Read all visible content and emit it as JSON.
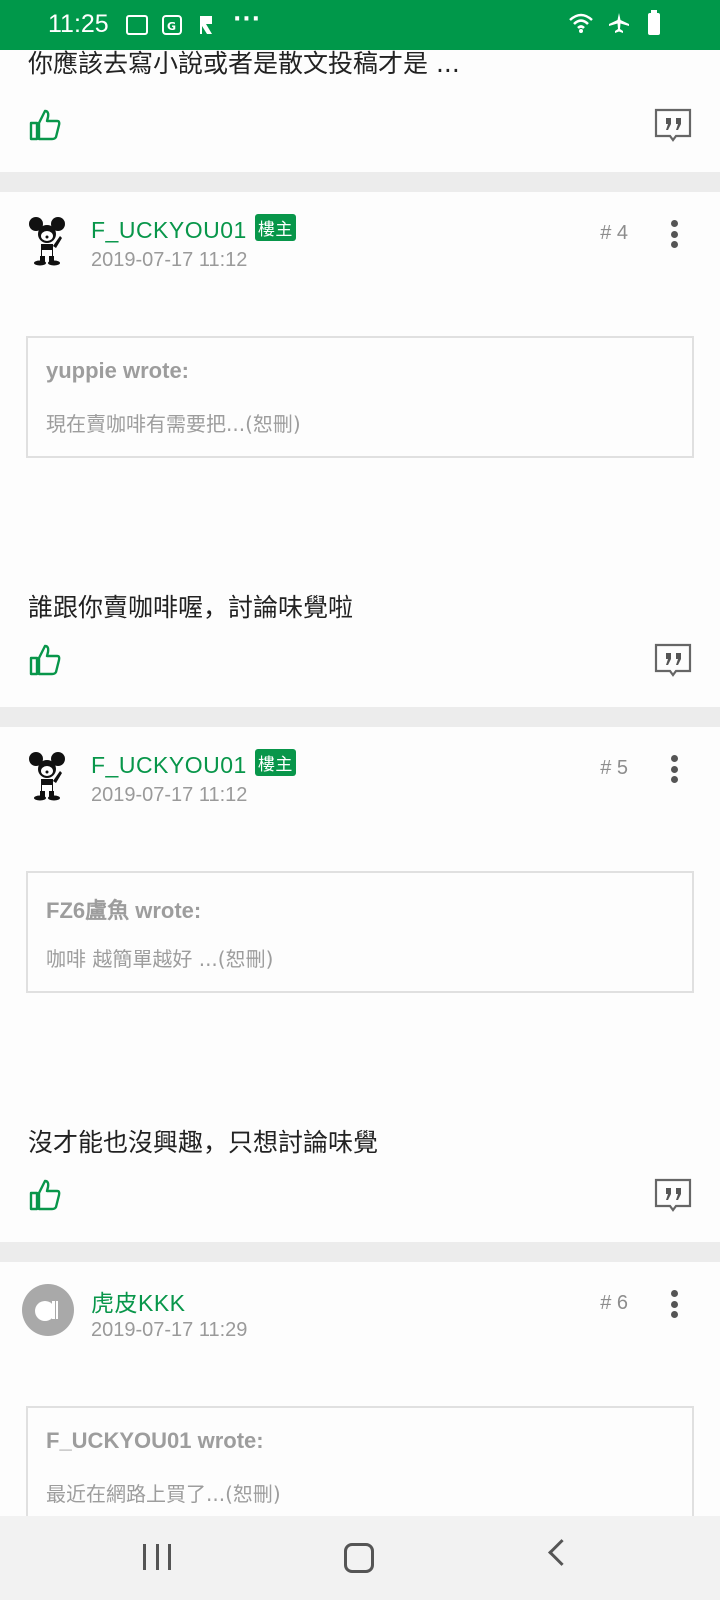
{
  "status_bar": {
    "time": "11:25",
    "icons_left": [
      "gallery-icon",
      "maps-icon",
      "app-icon",
      "more-notifications-icon"
    ],
    "icons_right": [
      "wifi-icon",
      "airplane-mode-icon",
      "battery-icon"
    ],
    "overflow_glyph": "···",
    "color": "#00984a"
  },
  "feed": {
    "top_post": {
      "text": "你應該去寫小說或者是散文投稿才是 ..."
    },
    "posts": [
      {
        "username": "F_UCKYOU01",
        "badge": "樓主",
        "date": "2019-07-17 11:12",
        "floor": "# 4",
        "quote_author": "yuppie wrote:",
        "quote_text": "現在賣咖啡有需要把...(恕刪)",
        "text": "誰跟你賣咖啡喔，討論味覺啦"
      },
      {
        "username": "F_UCKYOU01",
        "badge": "樓主",
        "date": "2019-07-17 11:12",
        "floor": "# 5",
        "quote_author": "FZ6盧魚 wrote:",
        "quote_text": "咖啡 越簡單越好 ...(恕刪)",
        "text": "沒才能也沒興趣，只想討論味覺"
      },
      {
        "username": "虎皮KKK",
        "date": "2019-07-17 11:29",
        "floor": "# 6",
        "quote_author": "F_UCKYOU01 wrote:",
        "quote_text": "最近在網路上買了...(恕刪)"
      }
    ]
  },
  "colors": {
    "accent": "#08964a",
    "muted": "#9a9a9a",
    "divider": "#ececec"
  }
}
